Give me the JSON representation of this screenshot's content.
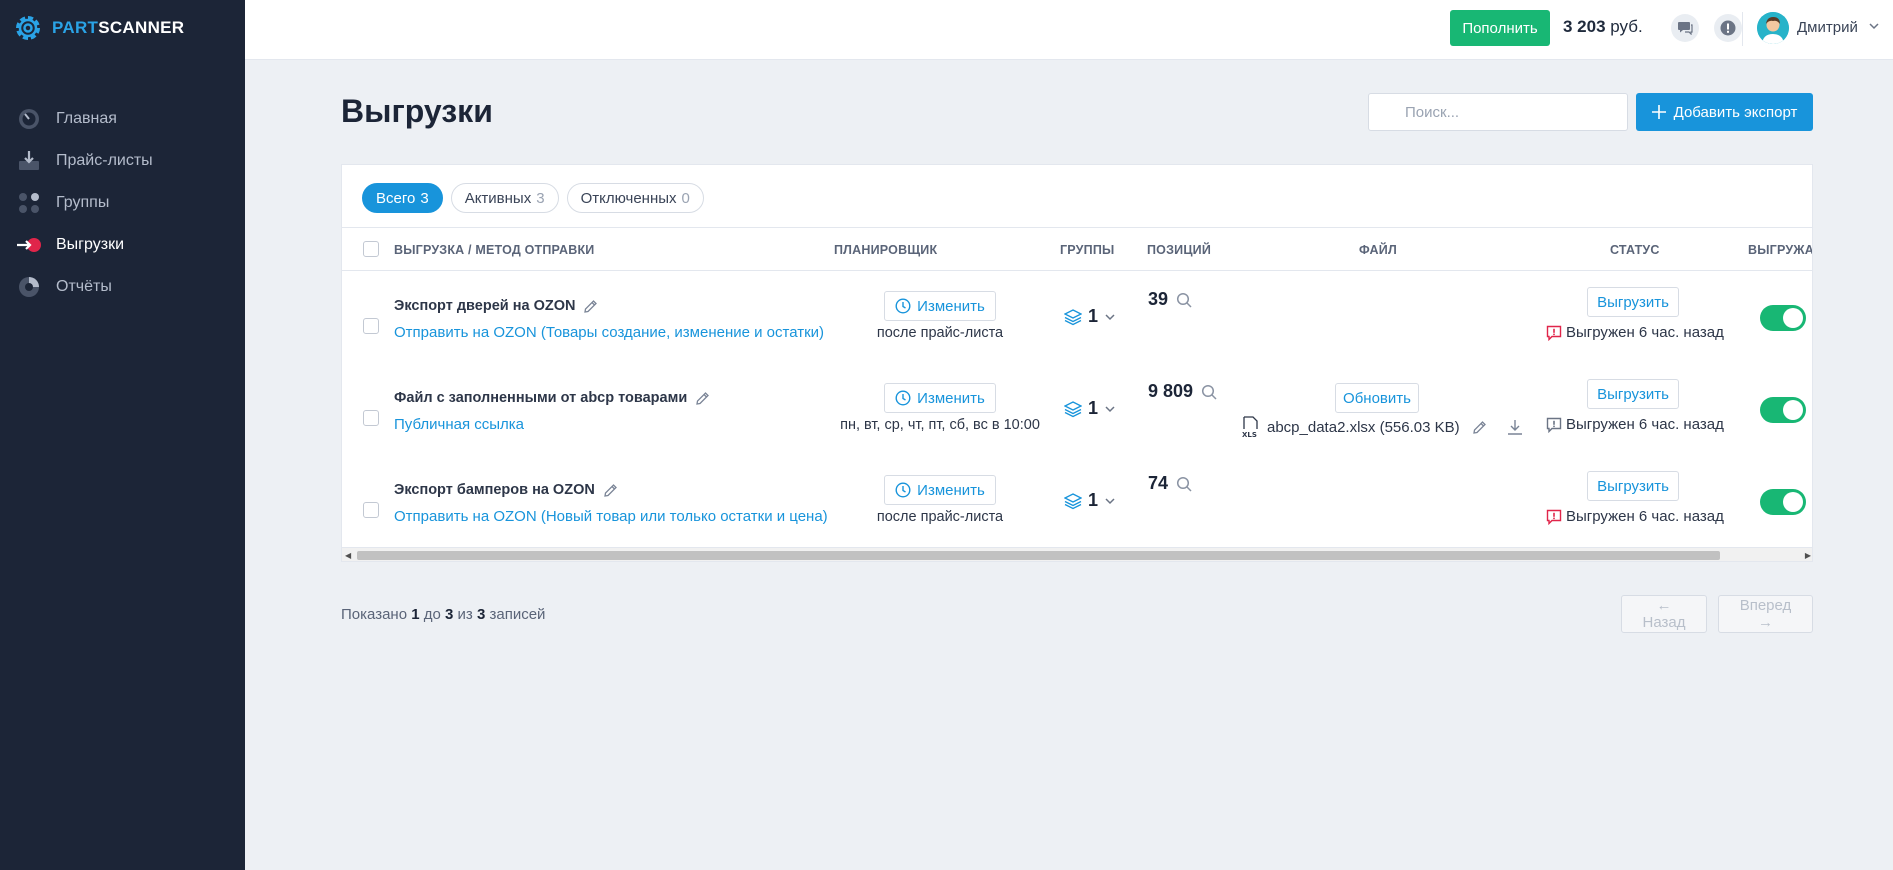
{
  "app": {
    "logo_part": "PART",
    "logo_scanner": "SCANNER"
  },
  "sidebar": {
    "items": [
      {
        "label": "Главная",
        "icon": "gauge-icon",
        "active": false
      },
      {
        "label": "Прайс-листы",
        "icon": "tray-download-icon",
        "active": false
      },
      {
        "label": "Группы",
        "icon": "groups-icon",
        "active": false
      },
      {
        "label": "Выгрузки",
        "icon": "export-arrow-icon",
        "active": true
      },
      {
        "label": "Отчёты",
        "icon": "pie-chart-icon",
        "active": false
      }
    ]
  },
  "topbar": {
    "topup_label": "Пополнить",
    "balance_amount": "3 203",
    "balance_currency": "руб.",
    "user_name": "Дмитрий"
  },
  "page": {
    "title": "Выгрузки",
    "search_placeholder": "Поиск...",
    "add_label": "Добавить экспорт"
  },
  "tabs": [
    {
      "label": "Всего",
      "count": "3",
      "active": true
    },
    {
      "label": "Активных",
      "count": "3",
      "active": false
    },
    {
      "label": "Отключенных",
      "count": "0",
      "active": false
    }
  ],
  "table": {
    "headers": {
      "export": "ВЫГРУЗКА / МЕТОД ОТПРАВКИ",
      "scheduler": "ПЛАНИРОВЩИК",
      "groups": "ГРУППЫ",
      "positions": "ПОЗИЦИЙ",
      "file": "ФАЙЛ",
      "status": "СТАТУС",
      "unload": "ВЫГРУЖАТЬ"
    },
    "rows": [
      {
        "name": "Экспорт дверей на OZON",
        "method": "Отправить на OZON (Товары создание, изменение и остатки)",
        "schedule_button": "Изменить",
        "schedule": "после прайс-листа",
        "groups": "1",
        "positions": "39",
        "file": "",
        "unload_button": "Выгрузить",
        "status": "Выгружен 6 час. назад",
        "status_color": "#e0254a",
        "enabled": true
      },
      {
        "name": "Файл с заполненными от abcp товарами",
        "method": "Публичная ссылка",
        "schedule_button": "Изменить",
        "schedule": "пн, вт, ср, чт, пт, сб, вс в 10:00",
        "groups": "1",
        "positions": "9 809",
        "file_update_button": "Обновить",
        "file": "abcp_data2.xlsx (556.03 KB)",
        "unload_button": "Выгрузить",
        "status": "Выгружен 6 час. назад",
        "status_color": "#6b7485",
        "enabled": true
      },
      {
        "name": "Экспорт бамперов на OZON",
        "method": "Отправить на OZON (Новый товар или только остатки и цена)",
        "schedule_button": "Изменить",
        "schedule": "после прайс-листа",
        "groups": "1",
        "positions": "74",
        "file": "",
        "unload_button": "Выгрузить",
        "status": "Выгружен 6 час. назад",
        "status_color": "#e0254a",
        "enabled": true
      }
    ]
  },
  "pagination": {
    "prefix": "Показано",
    "from": "1",
    "to_word": "до",
    "to": "3",
    "of_word": "из",
    "total": "3",
    "suffix": "записей",
    "prev_label": "← Назад",
    "next_label": "Вперед →"
  },
  "colors": {
    "accent": "#1894db",
    "success": "#18b774",
    "sidebar": "#1c2537",
    "danger": "#e0254a"
  }
}
